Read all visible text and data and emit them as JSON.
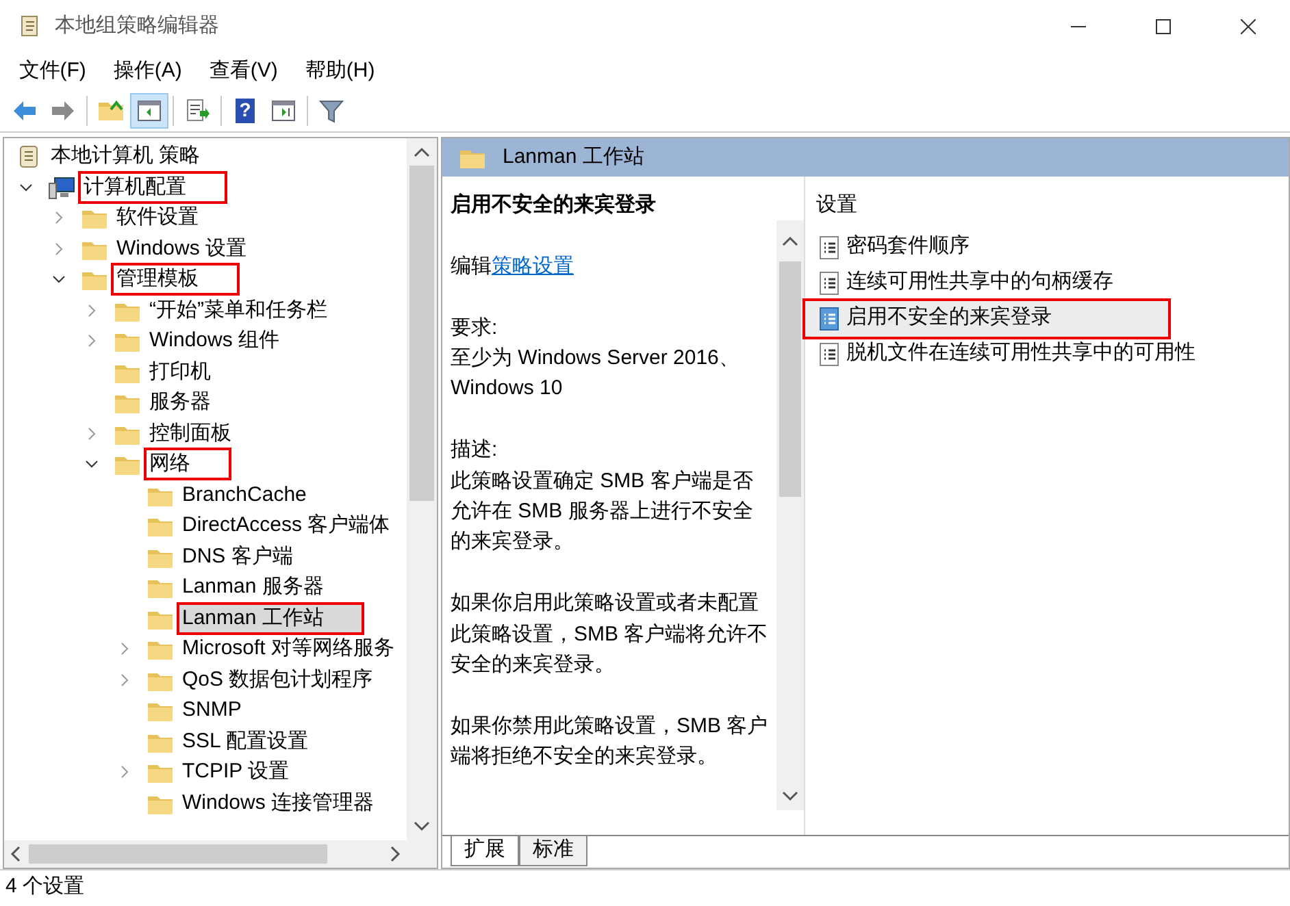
{
  "window": {
    "title": "本地组策略编辑器"
  },
  "menu": [
    "文件(F)",
    "操作(A)",
    "查看(V)",
    "帮助(H)"
  ],
  "toolbar": [
    {
      "kind": "back",
      "pressed": false
    },
    {
      "kind": "forward",
      "pressed": false
    },
    {
      "kind": "sep"
    },
    {
      "kind": "up",
      "pressed": false
    },
    {
      "kind": "tree",
      "pressed": true
    },
    {
      "kind": "sep"
    },
    {
      "kind": "export",
      "pressed": false
    },
    {
      "kind": "sep"
    },
    {
      "kind": "help",
      "glyph": "?",
      "pressed": false
    },
    {
      "kind": "action",
      "pressed": false
    },
    {
      "kind": "sep"
    },
    {
      "kind": "filter",
      "pressed": false
    }
  ],
  "tree": [
    {
      "label": "本地计算机 策略",
      "kind": "root",
      "selected": false,
      "outlined": false,
      "children": [
        {
          "label": "计算机配置",
          "kind": "computer",
          "expanded": true,
          "selected": false,
          "outlined": true,
          "children": [
            {
              "label": "软件设置",
              "kind": "folder",
              "expanded": false,
              "selected": false,
              "outlined": false
            },
            {
              "label": "Windows 设置",
              "kind": "folder",
              "expanded": false,
              "selected": false,
              "outlined": false
            },
            {
              "label": "管理模板",
              "kind": "folder",
              "expanded": true,
              "selected": false,
              "outlined": true,
              "children": [
                {
                  "label": "“开始”菜单和任务栏",
                  "kind": "folder",
                  "expanded": false,
                  "selected": false,
                  "outlined": false
                },
                {
                  "label": "Windows 组件",
                  "kind": "folder",
                  "expanded": false,
                  "selected": false,
                  "outlined": false
                },
                {
                  "label": "打印机",
                  "kind": "folder",
                  "selected": false,
                  "outlined": false
                },
                {
                  "label": "服务器",
                  "kind": "folder",
                  "selected": false,
                  "outlined": false
                },
                {
                  "label": "控制面板",
                  "kind": "folder",
                  "expanded": false,
                  "selected": false,
                  "outlined": false
                },
                {
                  "label": "网络",
                  "kind": "folder",
                  "expanded": true,
                  "selected": false,
                  "outlined": true,
                  "children": [
                    {
                      "label": "BranchCache",
                      "kind": "folder",
                      "selected": false,
                      "outlined": false
                    },
                    {
                      "label": "DirectAccess 客户端体",
                      "kind": "folder",
                      "selected": false,
                      "outlined": false
                    },
                    {
                      "label": "DNS 客户端",
                      "kind": "folder",
                      "selected": false,
                      "outlined": false
                    },
                    {
                      "label": "Lanman 服务器",
                      "kind": "folder",
                      "selected": false,
                      "outlined": false
                    },
                    {
                      "label": "Lanman 工作站",
                      "kind": "folder",
                      "selected": true,
                      "outlined": true
                    },
                    {
                      "label": "Microsoft 对等网络服务",
                      "kind": "folder",
                      "expanded": false,
                      "selected": false,
                      "outlined": false
                    },
                    {
                      "label": "QoS 数据包计划程序",
                      "kind": "folder",
                      "expanded": false,
                      "selected": false,
                      "outlined": false
                    },
                    {
                      "label": "SNMP",
                      "kind": "folder",
                      "selected": false,
                      "outlined": false
                    },
                    {
                      "label": "SSL 配置设置",
                      "kind": "folder",
                      "selected": false,
                      "outlined": false
                    },
                    {
                      "label": "TCPIP 设置",
                      "kind": "folder",
                      "expanded": false,
                      "selected": false,
                      "outlined": false
                    },
                    {
                      "label": "Windows 连接管理器",
                      "kind": "folder",
                      "selected": false,
                      "outlined": false
                    }
                  ]
                }
              ]
            }
          ]
        }
      ]
    }
  ],
  "detail": {
    "header": "Lanman 工作站",
    "title": "启用不安全的来宾登录",
    "edit_prefix": "编辑",
    "edit_link": "策略设置",
    "paragraphs": [
      [
        "要求:",
        "至少为 Windows Server 2016、Windows 10"
      ],
      [
        "描述:",
        "此策略设置确定 SMB 客户端是否允许在 SMB 服务器上进行不安全的来宾登录。"
      ],
      [
        "如果你启用此策略设置或者未配置此策略设置，SMB 客户端将允许不安全的来宾登录。"
      ],
      [
        "如果你禁用此策略设置，SMB 客户端将拒绝不安全的来宾登录。"
      ]
    ],
    "list_header": "设置",
    "settings": [
      {
        "label": "密码套件顺序",
        "selected": false,
        "outlined": false
      },
      {
        "label": "连续可用性共享中的句柄缓存",
        "selected": false,
        "outlined": false
      },
      {
        "label": "启用不安全的来宾登录",
        "selected": true,
        "outlined": true
      },
      {
        "label": "脱机文件在连续可用性共享中的可用性",
        "selected": false,
        "outlined": false
      }
    ]
  },
  "tabs": [
    {
      "label": "扩展",
      "selected": true
    },
    {
      "label": "标准",
      "selected": false
    }
  ],
  "status_bar": "4 个设置"
}
